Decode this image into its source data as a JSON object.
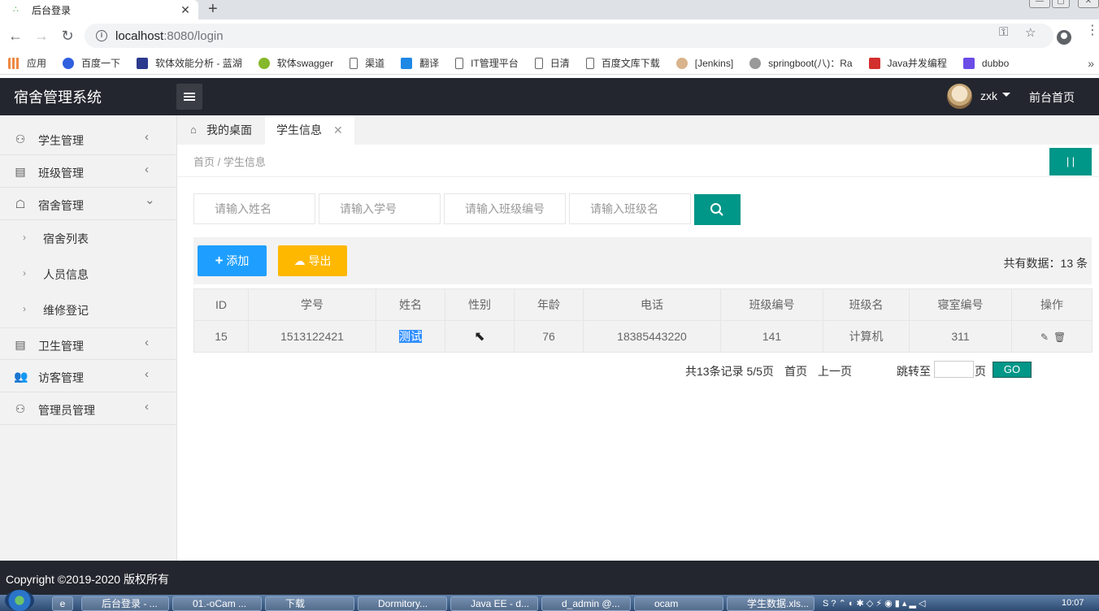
{
  "browser": {
    "tab_title": "后台登录",
    "url_host": "localhost",
    "url_rest": ":8080/login",
    "bookmarks": [
      "应用",
      "百度一下",
      "软体效能分析 - 蓝湖",
      "软体swagger",
      "渠道",
      "翻译",
      "IT管理平台",
      "日清",
      "百度文库下载",
      "[Jenkins]",
      "springboot(八)：Ra",
      "Java并发编程",
      "dubbo"
    ]
  },
  "header": {
    "logo": "宿舍管理系统",
    "username": "zxk",
    "front_link": "前台首页"
  },
  "sidebar": {
    "items": [
      {
        "label": "学生管理"
      },
      {
        "label": "班级管理"
      },
      {
        "label": "宿舍管理"
      },
      {
        "label": "宿舍列表"
      },
      {
        "label": "人员信息"
      },
      {
        "label": "维修登记"
      },
      {
        "label": "卫生管理"
      },
      {
        "label": "访客管理"
      },
      {
        "label": "管理员管理"
      }
    ]
  },
  "tabs": {
    "home": "我的桌面",
    "current": "学生信息"
  },
  "breadcrumb": "首页 / 学生信息",
  "search": {
    "name_ph": "请输入姓名",
    "sno_ph": "请输入学号",
    "class_no_ph": "请输入班级编号",
    "class_name_ph": "请输入班级名"
  },
  "toolbar": {
    "add_label": "添加",
    "export_label": "导出",
    "total": "共有数据：13 条"
  },
  "table": {
    "headers": [
      "ID",
      "学号",
      "姓名",
      "性别",
      "年龄",
      "电话",
      "班级编号",
      "班级名",
      "寝室编号",
      "操作"
    ],
    "row": [
      "15",
      "1513122421",
      "测试",
      "",
      "76",
      "18385443220",
      "141",
      "计算机",
      "311"
    ]
  },
  "pager": {
    "summary": "共13条记录  5/5页",
    "first": "首页",
    "prev": "上一页",
    "jump_label": "跳转至",
    "page_suffix": "页",
    "go": "GO"
  },
  "footer": "Copyright ©2019-2020 版权所有",
  "taskbar": {
    "items": [
      "后台登录 - ...",
      "01.-oCam ...",
      "下载",
      "Dormitory...",
      "Java EE - d...",
      "d_admin @...",
      "ocam",
      "学生数据.xls..."
    ],
    "clock": "10:07"
  },
  "colors": {
    "accent": "#009688",
    "blue": "#1e9fff",
    "yellow": "#ffb800",
    "header": "#23262e"
  }
}
